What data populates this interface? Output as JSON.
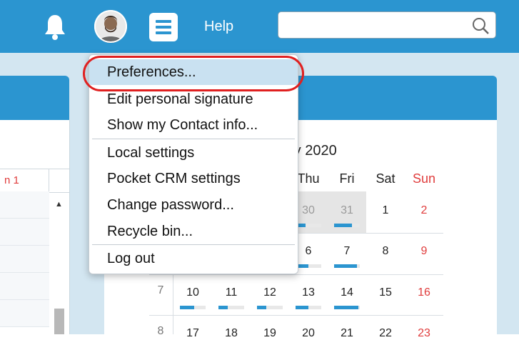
{
  "topbar": {
    "icons": [
      "bell-icon",
      "avatar",
      "menu-icon"
    ],
    "help_label": "Help",
    "search": {
      "value": "",
      "placeholder": "",
      "icon": "search-icon"
    },
    "color": "#2b95d0"
  },
  "left_panel": {
    "column_header": "n 1"
  },
  "calendar": {
    "title": "ry 2020",
    "weekdays": [
      {
        "label": "Thu",
        "color": "#222222"
      },
      {
        "label": "Fri",
        "color": "#222222"
      },
      {
        "label": "Sat",
        "color": "#222222"
      },
      {
        "label": "Sun",
        "color": "#e03d3d"
      }
    ],
    "weeks": [
      {
        "number": "",
        "days": [
          {
            "label": "30",
            "other_month": true,
            "bar": 0.4
          },
          {
            "label": "31",
            "other_month": true,
            "bar": 0.7
          },
          {
            "label": "1",
            "bar": null
          },
          {
            "label": "2",
            "weekend": true,
            "bar": null
          }
        ]
      },
      {
        "number": "",
        "days": [
          {
            "label": "6",
            "bar": 0.5
          },
          {
            "label": "7",
            "bar": 0.9
          },
          {
            "label": "8",
            "bar": null
          },
          {
            "label": "9",
            "weekend": true,
            "bar": null
          }
        ]
      },
      {
        "number": "7",
        "days": [
          {
            "label": "10",
            "bar": 0.55
          },
          {
            "label": "11",
            "bar": 0.35
          },
          {
            "label": "12",
            "bar": 0.35
          },
          {
            "label": "13",
            "bar": 0.5
          },
          {
            "label": "14",
            "bar": 0.95
          },
          {
            "label": "15",
            "bar": null
          },
          {
            "label": "16",
            "weekend": true,
            "bar": null
          }
        ]
      },
      {
        "number": "8",
        "days": [
          {
            "label": "17"
          },
          {
            "label": "18"
          },
          {
            "label": "19"
          },
          {
            "label": "20"
          },
          {
            "label": "21"
          },
          {
            "label": "22"
          },
          {
            "label": "23",
            "weekend": true
          }
        ]
      }
    ]
  },
  "user_menu": {
    "items": [
      {
        "label": "Preferences...",
        "hovered": true
      },
      {
        "label": "Edit personal signature"
      },
      {
        "label": "Show my Contact info..."
      },
      {
        "label": "Local settings"
      },
      {
        "label": "Pocket CRM settings"
      },
      {
        "label": "Change password..."
      },
      {
        "label": "Recycle bin..."
      },
      {
        "label": "Log out"
      }
    ],
    "highlight_color": "#e02020"
  }
}
